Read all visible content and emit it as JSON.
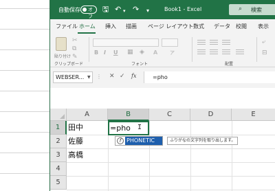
{
  "titlebar": {
    "autosave_label": "自動保存",
    "autosave_state": "オフ",
    "title": "Book1 - Excel",
    "search_label": "検索"
  },
  "ribbon_tabs": [
    "ファイル",
    "ホーム",
    "挿入",
    "描画",
    "ページ レイアウト",
    "数式",
    "データ",
    "校閲",
    "表示"
  ],
  "ribbon": {
    "paste_label": "貼り付け",
    "clipboard_group": "クリップボード",
    "font_group": "フォント",
    "alignment_group": "配置"
  },
  "formula_bar": {
    "name_box": "WEBSER...",
    "fx": "fx",
    "content": "=pho"
  },
  "grid": {
    "columns": [
      "A",
      "B",
      "C",
      "D",
      "E"
    ],
    "rows": [
      "1",
      "2",
      "3",
      "4",
      "5"
    ],
    "cells": {
      "A1": "田中",
      "A2": "佐藤",
      "A3": "高橋",
      "B1": "=pho"
    }
  },
  "autocomplete": {
    "item": "PHONETIC",
    "tooltip": "ふりがなの文字列を取り出します。"
  },
  "colors": {
    "excel_green": "#217346",
    "selection_blue": "#1e5fad"
  }
}
